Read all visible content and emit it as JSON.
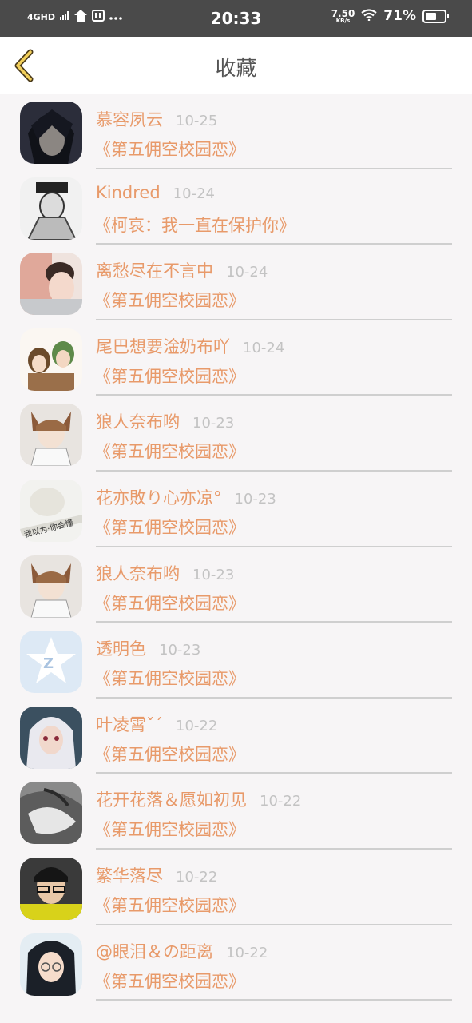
{
  "status_bar": {
    "network": "4GHD",
    "time": "20:33",
    "net_speed": "7.50",
    "net_speed_unit": "KB/s",
    "battery": "71%",
    "battery_level": 0.71
  },
  "header": {
    "title": "收藏"
  },
  "items": [
    {
      "user": "慕容夙云",
      "date": "10-25",
      "title": "《第五佣空校园恋》"
    },
    {
      "user": "Kindred",
      "date": "10-24",
      "title": "《柯哀：我一直在保护你》"
    },
    {
      "user": "离愁尽在不言中",
      "date": "10-24",
      "title": "《第五佣空校园恋》"
    },
    {
      "user": "尾巴想要淦奶布吖",
      "date": "10-24",
      "title": "《第五佣空校园恋》"
    },
    {
      "user": "狼人奈布哟",
      "date": "10-23",
      "title": "《第五佣空校园恋》"
    },
    {
      "user": "花亦敗り心亦凉°",
      "date": "10-23",
      "title": "《第五佣空校园恋》"
    },
    {
      "user": "狼人奈布哟",
      "date": "10-23",
      "title": "《第五佣空校园恋》"
    },
    {
      "user": "透明色",
      "date": "10-23",
      "title": "《第五佣空校园恋》"
    },
    {
      "user": "叶凌霄ˇˊ",
      "date": "10-22",
      "title": "《第五佣空校园恋》"
    },
    {
      "user": "花开花落＆愿如初见",
      "date": "10-22",
      "title": "《第五佣空校园恋》"
    },
    {
      "user": "繁华落尽",
      "date": "10-22",
      "title": "《第五佣空校园恋》"
    },
    {
      "user": "@眼泪＆の距离",
      "date": "10-22",
      "title": "《第五佣空校园恋》"
    }
  ]
}
